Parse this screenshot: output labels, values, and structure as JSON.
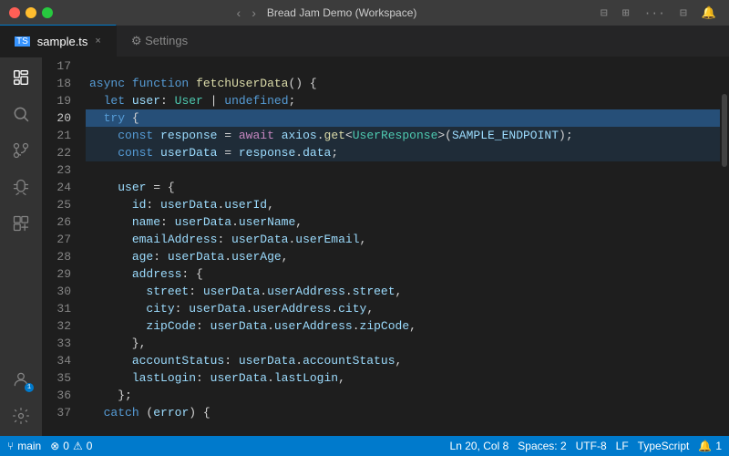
{
  "titleBar": {
    "title": "Bread Jam Demo (Workspace)",
    "backBtn": "‹",
    "forwardBtn": "›"
  },
  "tabs": [
    {
      "name": "sample.ts",
      "active": true,
      "icon": "TS",
      "hasClose": true
    },
    {
      "name": "Settings",
      "active": false,
      "hasClose": false
    }
  ],
  "activityBar": {
    "icons": [
      "⎘",
      "🔍",
      "⑂",
      "🐛",
      "⊞"
    ],
    "bottomIcons": [
      "👤",
      "⚙"
    ]
  },
  "statusBar": {
    "branch": "main",
    "errors": "0",
    "warnings": "0",
    "line": "Ln 20, Col 8",
    "spaces": "Spaces: 2",
    "encoding": "UTF-8",
    "lineEnding": "LF",
    "language": "TypeScript",
    "notifications": "1"
  },
  "code": {
    "lines": [
      {
        "num": 17,
        "content": ""
      },
      {
        "num": 18,
        "content": "async function fetchUserData() {"
      },
      {
        "num": 19,
        "content": "  let user: User | undefined;",
        "warn": true
      },
      {
        "num": 20,
        "content": "  try {",
        "active": true
      },
      {
        "num": 21,
        "content": "    const response = await axios.get<UserResponse>(SAMPLE_ENDPOINT);"
      },
      {
        "num": 22,
        "content": "    const userData = response.data;"
      },
      {
        "num": 23,
        "content": ""
      },
      {
        "num": 24,
        "content": "    user = {"
      },
      {
        "num": 25,
        "content": "      id: userData.userId,"
      },
      {
        "num": 26,
        "content": "      name: userData.userName,"
      },
      {
        "num": 27,
        "content": "      emailAddress: userData.userEmail,"
      },
      {
        "num": 28,
        "content": "      age: userData.userAge,"
      },
      {
        "num": 29,
        "content": "      address: {"
      },
      {
        "num": 30,
        "content": "        street: userData.userAddress.street,"
      },
      {
        "num": 31,
        "content": "        city: userData.userAddress.city,"
      },
      {
        "num": 32,
        "content": "        zipCode: userData.userAddress.zipCode,"
      },
      {
        "num": 33,
        "content": "      },"
      },
      {
        "num": 34,
        "content": "      accountStatus: userData.accountStatus,"
      },
      {
        "num": 35,
        "content": "      lastLogin: userData.lastLogin,"
      },
      {
        "num": 36,
        "content": "    };"
      },
      {
        "num": 37,
        "content": "    catch (error) {"
      }
    ]
  }
}
